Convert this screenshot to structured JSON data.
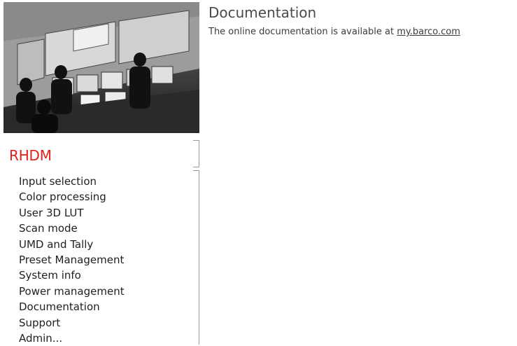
{
  "hero": {
    "icon": "control-room-photo"
  },
  "sidebar": {
    "brand": "RHDM",
    "brand_color": "#e0201b",
    "items": [
      {
        "label": "Input selection"
      },
      {
        "label": "Color processing"
      },
      {
        "label": "User 3D LUT"
      },
      {
        "label": "Scan mode"
      },
      {
        "label": "UMD and Tally"
      },
      {
        "label": "Preset Management"
      },
      {
        "label": "System info"
      },
      {
        "label": "Power management"
      },
      {
        "label": "Documentation"
      },
      {
        "label": "Support"
      },
      {
        "label": "Admin..."
      }
    ]
  },
  "main": {
    "title": "Documentation",
    "text": "The online documentation is available at",
    "link": "my.barco.com"
  }
}
